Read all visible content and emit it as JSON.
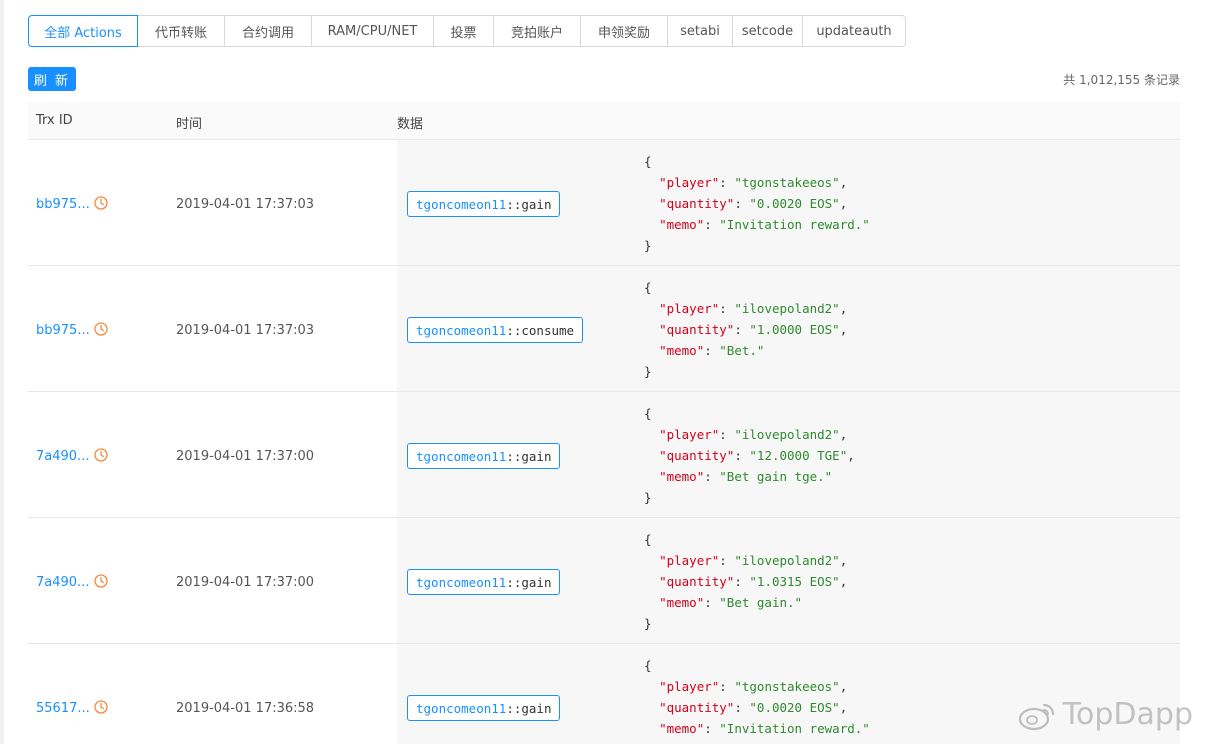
{
  "tabs": [
    {
      "label": "全部 Actions",
      "active": true,
      "width": 110
    },
    {
      "label": "代币转账",
      "width": 87
    },
    {
      "label": "合约调用",
      "width": 87
    },
    {
      "label": "RAM/CPU/NET",
      "width": 122
    },
    {
      "label": "投票",
      "width": 60
    },
    {
      "label": "竞拍账户",
      "width": 87
    },
    {
      "label": "申领奖励",
      "width": 87
    },
    {
      "label": "setabi",
      "width": 65
    },
    {
      "label": "setcode",
      "width": 70
    },
    {
      "label": "updateauth",
      "width": 103
    }
  ],
  "toolbar": {
    "refresh_label": "刷 新",
    "total_text": "共 1,012,155 条记录"
  },
  "table": {
    "headers": {
      "trx": "Trx ID",
      "time": "时间",
      "data": "数据"
    },
    "rows": [
      {
        "trx": "bb975...",
        "time": "2019-04-01 17:37:03",
        "account": "tgoncomeon11",
        "action": "gain",
        "player": "\"tgonstakeeos\"",
        "quantity": "\"0.0020 EOS\"",
        "memo": "\"Invitation reward.\""
      },
      {
        "trx": "bb975...",
        "time": "2019-04-01 17:37:03",
        "account": "tgoncomeon11",
        "action": "consume",
        "player": "\"ilovepoland2\"",
        "quantity": "\"1.0000 EOS\"",
        "memo": "\"Bet.\""
      },
      {
        "trx": "7a490...",
        "time": "2019-04-01 17:37:00",
        "account": "tgoncomeon11",
        "action": "gain",
        "player": "\"ilovepoland2\"",
        "quantity": "\"12.0000 TGE\"",
        "memo": "\"Bet gain tge.\""
      },
      {
        "trx": "7a490...",
        "time": "2019-04-01 17:37:00",
        "account": "tgoncomeon11",
        "action": "gain",
        "player": "\"ilovepoland2\"",
        "quantity": "\"1.0315 EOS\"",
        "memo": "\"Bet gain.\""
      },
      {
        "trx": "55617...",
        "time": "2019-04-01 17:36:58",
        "account": "tgoncomeon11",
        "action": "gain",
        "player": "\"tgonstakeeos\"",
        "quantity": "\"0.0020 EOS\"",
        "memo": "\"Invitation reward.\""
      }
    ]
  },
  "json_keys": {
    "player": "\"player\"",
    "quantity": "\"quantity\"",
    "memo": "\"memo\""
  },
  "watermark": "TopDapp",
  "colors": {
    "accent": "#1890ff",
    "json_key": "#d0021b",
    "json_value": "#2f8a2f",
    "clock": "#f5893a"
  }
}
